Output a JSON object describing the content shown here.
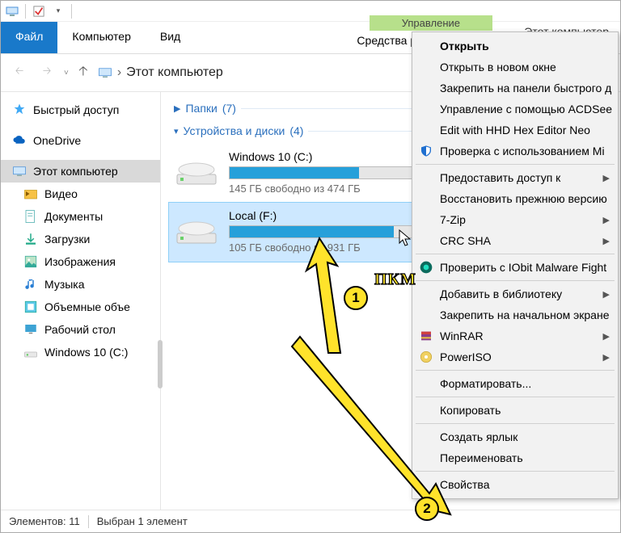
{
  "window": {
    "title": "Этот компьютер"
  },
  "ribbon": {
    "file": "Файл",
    "tabs": [
      "Компьютер",
      "Вид"
    ],
    "ctx_header": "Управление",
    "ctx_tab": "Средства работы с дисками"
  },
  "address": {
    "location": "Этот компьютер"
  },
  "sidebar": {
    "quick": "Быстрый доступ",
    "onedrive": "OneDrive",
    "thispc": "Этот компьютер",
    "children": [
      {
        "label": "Видео"
      },
      {
        "label": "Документы"
      },
      {
        "label": "Загрузки"
      },
      {
        "label": "Изображения"
      },
      {
        "label": "Музыка"
      },
      {
        "label": "Объемные объе"
      },
      {
        "label": "Рабочий стол"
      },
      {
        "label": "Windows 10 (C:)"
      }
    ]
  },
  "groups": {
    "folders": {
      "label": "Папки",
      "count": "(7)"
    },
    "drives": {
      "label": "Устройства и диски",
      "count": "(4)"
    }
  },
  "drives": [
    {
      "name": "Windows 10 (C:)",
      "free": "145 ГБ свободно из 474 ГБ",
      "fill_pct": 70
    },
    {
      "name": "Local (F:)",
      "free": "105 ГБ свободно из 931 ГБ",
      "fill_pct": 89
    }
  ],
  "status": {
    "items": "Элементов: 11",
    "selected": "Выбран 1 элемент"
  },
  "ctxmenu": {
    "items": [
      {
        "t": "Открыть",
        "bold": true
      },
      {
        "t": "Открыть в новом окне"
      },
      {
        "t": "Закрепить на панели быстрого д"
      },
      {
        "t": "Управление с помощью ACDSee"
      },
      {
        "t": "Edit with HHD Hex Editor Neo"
      },
      {
        "t": "Проверка с использованием Mi",
        "ico": "shield"
      },
      {
        "sep": true
      },
      {
        "t": "Предоставить доступ к",
        "sub": true
      },
      {
        "t": "Восстановить прежнюю версию"
      },
      {
        "t": "7-Zip",
        "sub": true
      },
      {
        "t": "CRC SHA",
        "sub": true
      },
      {
        "sep": true
      },
      {
        "t": "Проверить с IObit Malware Fight",
        "ico": "iobit"
      },
      {
        "sep": true
      },
      {
        "t": "Добавить в библиотеку",
        "sub": true
      },
      {
        "t": "Закрепить на начальном экране"
      },
      {
        "t": "WinRAR",
        "ico": "winrar",
        "sub": true
      },
      {
        "t": "PowerISO",
        "ico": "poweriso",
        "sub": true
      },
      {
        "sep": true
      },
      {
        "t": "Форматировать..."
      },
      {
        "sep": true
      },
      {
        "t": "Копировать"
      },
      {
        "sep": true
      },
      {
        "t": "Создать ярлык"
      },
      {
        "t": "Переименовать"
      },
      {
        "sep": true
      },
      {
        "t": "Свойства"
      }
    ]
  },
  "anno": {
    "n1": "1",
    "n2": "2",
    "nkm": "ПКМ"
  }
}
